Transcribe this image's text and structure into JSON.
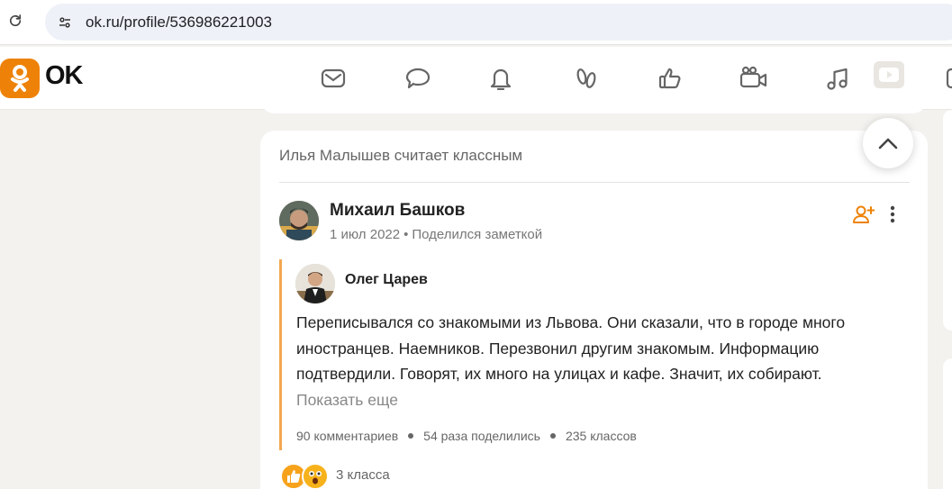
{
  "browser": {
    "url": "ok.ru/profile/536986221003"
  },
  "header": {
    "logo_text": "OK",
    "nav_icons": [
      "mail-icon",
      "chat-icon",
      "bell-icon",
      "guests-icon",
      "like-icon",
      "video-camera-icon",
      "music-icon",
      "video-play-icon",
      "games-icon"
    ]
  },
  "post": {
    "context": "Илья Малышев считает классным",
    "author": "Михаил Башков",
    "date": "1 июл 2022",
    "meta_dot": "•",
    "action": "Поделился заметкой",
    "quote": {
      "author": "Олег Царев",
      "text": "Переписывался со знакомыми из Львова. Они сказали, что в городе много иностранцев. Наемников. Перезвонил другим знакомым. Информацию подтвердили. Говорят, их много на улицах и кафе. Значит, их собирают.",
      "show_more": "Показать еще",
      "stats": {
        "comments": "90 комментариев",
        "shares": "54 раза поделились",
        "likes": "235 классов"
      }
    },
    "reactions_count": "3 класса"
  },
  "colors": {
    "accent": "#ee8208",
    "quote_border": "#f3a74f",
    "background": "#f4f2ef"
  }
}
